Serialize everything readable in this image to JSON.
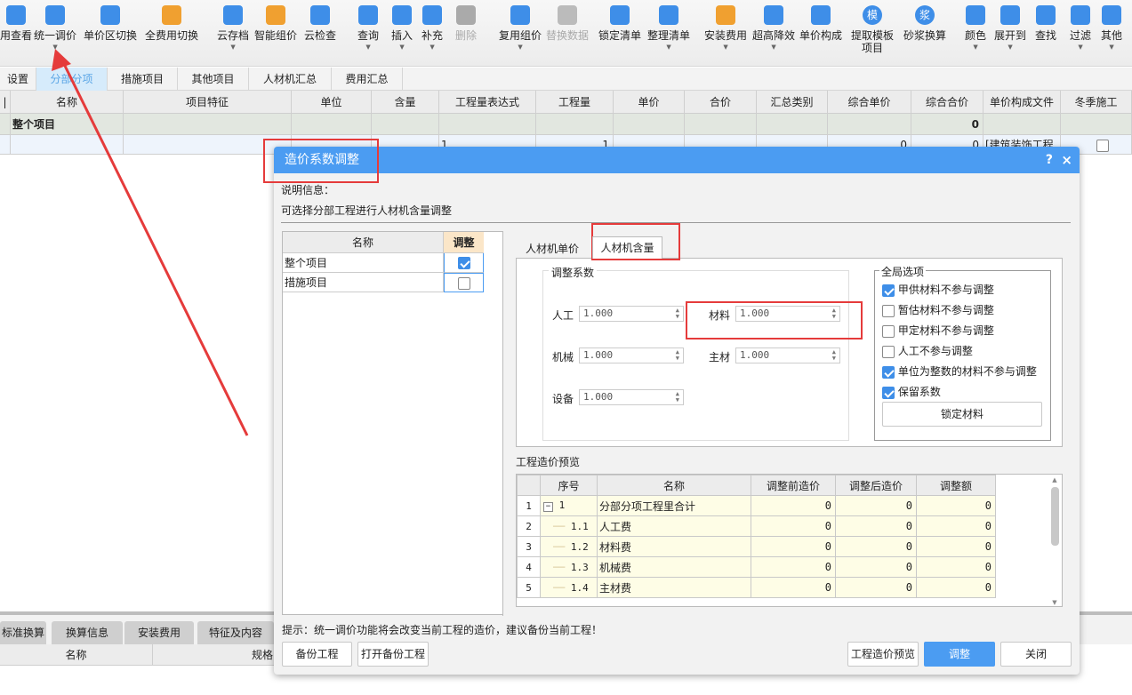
{
  "toolbar": {
    "items": [
      {
        "label": "用查看",
        "color": "#3e8ee8",
        "dropdown": false
      },
      {
        "label": "统一调价",
        "color": "#3e8ee8",
        "dropdown": true
      },
      {
        "label": "单价区切换",
        "color": "#3e8ee8",
        "dropdown": false
      },
      {
        "label": "全费用切换",
        "color": "#f0a030",
        "dropdown": false
      },
      {
        "label": "云存档",
        "color": "#3e8ee8",
        "dropdown": true
      },
      {
        "label": "智能组价",
        "color": "#f0a030",
        "dropdown": false
      },
      {
        "label": "云检查",
        "color": "#3e8ee8",
        "dropdown": false
      },
      {
        "label": "查询",
        "color": "#3e8ee8",
        "dropdown": true
      },
      {
        "label": "插入",
        "color": "#3e8ee8",
        "dropdown": true
      },
      {
        "label": "补充",
        "color": "#3e8ee8",
        "dropdown": true
      },
      {
        "label": "删除",
        "color": "#aaaaaa",
        "dropdown": false,
        "disabled": true
      },
      {
        "label": "复用组价",
        "color": "#3e8ee8",
        "dropdown": true
      },
      {
        "label": "替换数据",
        "color": "#bbbbbb",
        "dropdown": false,
        "disabled": true
      },
      {
        "label": "锁定清单",
        "color": "#3e8ee8",
        "dropdown": false
      },
      {
        "label": "整理清单",
        "color": "#3e8ee8",
        "dropdown": true
      },
      {
        "label": "安装费用",
        "color": "#f0a030",
        "dropdown": true
      },
      {
        "label": "超高降效",
        "color": "#3e8ee8",
        "dropdown": true
      },
      {
        "label": "单价构成",
        "color": "#3e8ee8",
        "dropdown": false
      },
      {
        "label": "提取模板\n项目",
        "color": "#3e8ee8",
        "dropdown": false,
        "glyph": "模"
      },
      {
        "label": "砂浆换算",
        "color": "#3e8ee8",
        "dropdown": false,
        "glyph": "浆"
      },
      {
        "label": "颜色",
        "color": "#3e8ee8",
        "dropdown": true
      },
      {
        "label": "展开到",
        "color": "#3e8ee8",
        "dropdown": true
      },
      {
        "label": "查找",
        "color": "#3e8ee8",
        "dropdown": false
      },
      {
        "label": "过滤",
        "color": "#3e8ee8",
        "dropdown": true
      },
      {
        "label": "其他",
        "color": "#3e8ee8",
        "dropdown": true
      }
    ]
  },
  "tabs": [
    {
      "label": "设置",
      "active": false
    },
    {
      "label": "分部分项",
      "active": true
    },
    {
      "label": "措施项目",
      "active": false
    },
    {
      "label": "其他项目",
      "active": false
    },
    {
      "label": "人材机汇总",
      "active": false
    },
    {
      "label": "费用汇总",
      "active": false
    }
  ],
  "grid": {
    "columns": [
      "|",
      "名称",
      "项目特征",
      "单位",
      "含量",
      "工程量表达式",
      "工程量",
      "单价",
      "合价",
      "汇总类别",
      "综合单价",
      "综合合价",
      "单价构成文件",
      "冬季施工"
    ],
    "row1": {
      "name": "整个项目",
      "total": "0"
    },
    "row2": {
      "expr": "1",
      "qty": "1",
      "unit_price": "0",
      "total": "0",
      "file": "[建筑装饰工程…"
    }
  },
  "bottom": {
    "tabs": [
      "标准换算",
      "换算信息",
      "安装费用",
      "特征及内容"
    ],
    "columns": [
      "名称",
      "规格"
    ]
  },
  "dialog": {
    "title": "造价系数调整",
    "help": "?",
    "close": "×",
    "desc_label": "说明信息：",
    "desc_text": "可选择分部工程进行人材机含量调整",
    "left_table": {
      "headers": [
        "名称",
        "调整"
      ],
      "rows": [
        {
          "name": "整个项目",
          "checked": true
        },
        {
          "name": "措施项目",
          "checked": false
        }
      ]
    },
    "tabs": [
      {
        "label": "人材机单价",
        "active": false
      },
      {
        "label": "人材机含量",
        "active": true
      }
    ],
    "coef_group": "调整系数",
    "coefs": [
      {
        "label": "人工",
        "value": "1.000"
      },
      {
        "label": "材料",
        "value": "1.000"
      },
      {
        "label": "机械",
        "value": "1.000"
      },
      {
        "label": "主材",
        "value": "1.000"
      },
      {
        "label": "设备",
        "value": "1.000"
      }
    ],
    "global_group": "全局选项",
    "options": [
      {
        "label": "甲供材料不参与调整",
        "checked": true
      },
      {
        "label": "暂估材料不参与调整",
        "checked": false
      },
      {
        "label": "甲定材料不参与调整",
        "checked": false
      },
      {
        "label": "人工不参与调整",
        "checked": false
      },
      {
        "label": "单位为整数的材料不参与调整",
        "checked": true
      },
      {
        "label": "保留系数",
        "checked": true
      }
    ],
    "lock_button": "锁定材料",
    "preview_label": "工程造价预览",
    "preview": {
      "headers": [
        "",
        "序号",
        "名称",
        "调整前造价",
        "调整后造价",
        "调整额"
      ],
      "rows": [
        {
          "idx": "1",
          "code": "1",
          "name": "分部分项工程里合计",
          "before": "0",
          "after": "0",
          "diff": "0",
          "expander": "−"
        },
        {
          "idx": "2",
          "code": "1.1",
          "name": "人工费",
          "before": "0",
          "after": "0",
          "diff": "0"
        },
        {
          "idx": "3",
          "code": "1.2",
          "name": "材料费",
          "before": "0",
          "after": "0",
          "diff": "0"
        },
        {
          "idx": "4",
          "code": "1.3",
          "name": "机械费",
          "before": "0",
          "after": "0",
          "diff": "0"
        },
        {
          "idx": "5",
          "code": "1.4",
          "name": "主材费",
          "before": "0",
          "after": "0",
          "diff": "0"
        }
      ]
    },
    "hint": "提示：统一调价功能将会改变当前工程的造价，建议备份当前工程！",
    "buttons": {
      "backup": "备份工程",
      "open_backup": "打开备份工程",
      "preview": "工程造价预览",
      "adjust": "调整",
      "close": "关闭"
    }
  }
}
